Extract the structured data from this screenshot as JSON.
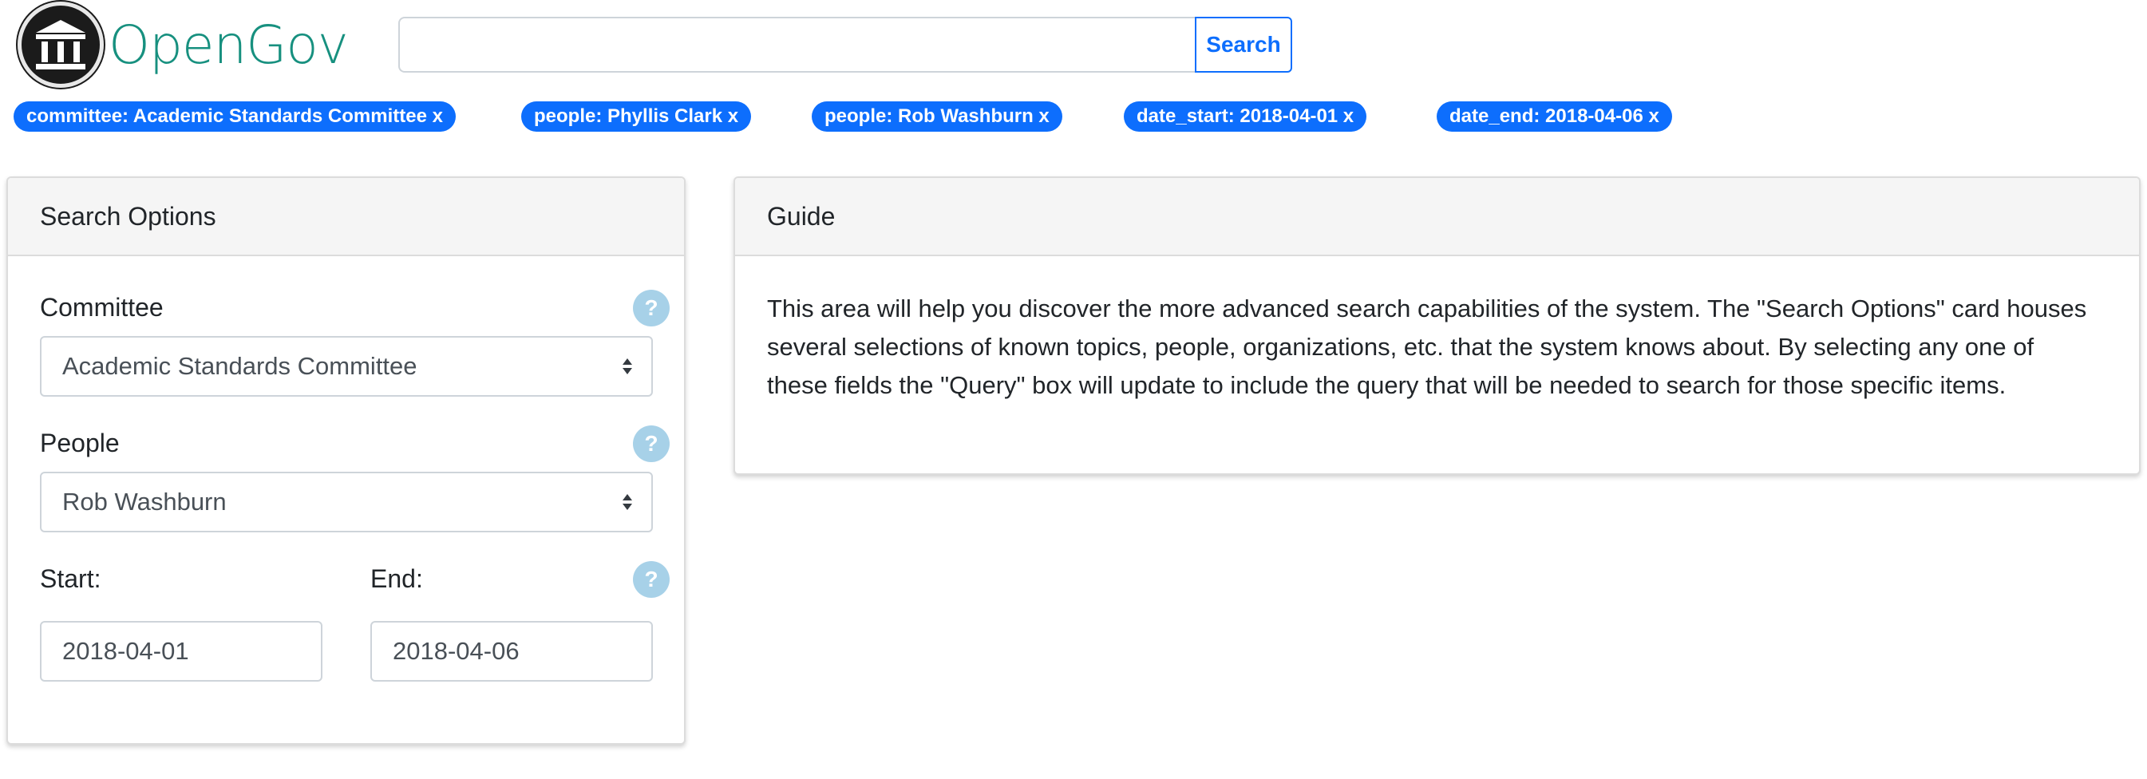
{
  "header": {
    "logo_text": "OpenGov",
    "search_value": "",
    "search_button": "Search"
  },
  "tags": [
    {
      "label": "committee: Academic Standards Committee x"
    },
    {
      "label": "people: Phyllis Clark x"
    },
    {
      "label": "people: Rob Washburn x"
    },
    {
      "label": "date_start: 2018-04-01 x"
    },
    {
      "label": "date_end: 2018-04-06 x"
    }
  ],
  "search_options": {
    "title": "Search Options",
    "committee_label": "Committee",
    "committee_value": "Academic Standards Committee",
    "people_label": "People",
    "people_value": "Rob Washburn",
    "start_label": "Start:",
    "start_value": "2018-04-01",
    "end_label": "End:",
    "end_value": "2018-04-06",
    "help_glyph": "?"
  },
  "guide": {
    "title": "Guide",
    "text": "This area will help you discover the more advanced search capabilities of the system. The \"Search Options\" card houses several selections of known topics, people, organizations, etc. that the system knows about. By selecting any one of these fields the \"Query\" box will update to include the query that will be needed to search for those specific items."
  },
  "colors": {
    "brand": "#17907f",
    "primary": "#0d6efd",
    "help": "#a7d1e8"
  }
}
